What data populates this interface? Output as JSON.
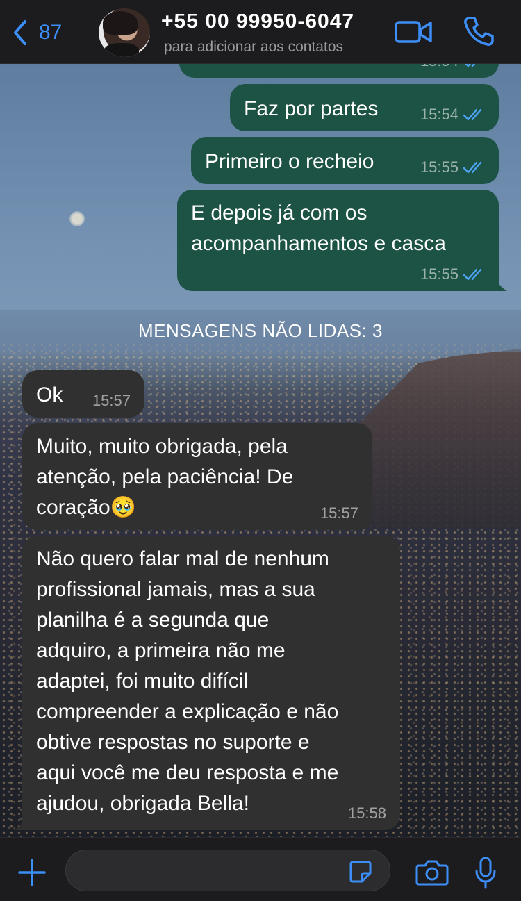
{
  "header": {
    "back_count": "87",
    "contact_name": "+55 00 99950-6047",
    "contact_subtitle": "para adicionar aos contatos",
    "accent_color": "#3d8ef7",
    "icons": [
      "chevron-left-icon",
      "video-camera-icon",
      "phone-icon"
    ]
  },
  "messages_read": [
    {
      "text": "Faz por partes",
      "time": "15:54",
      "direction": "outgoing",
      "status": "read"
    },
    {
      "text": "Primeiro o recheio",
      "time": "15:55",
      "direction": "outgoing",
      "status": "read"
    },
    {
      "text": "E depois já com os\nacompanhamentos e casca",
      "time": "15:55",
      "direction": "outgoing",
      "status": "read"
    }
  ],
  "partial_top_message_time": "15:54",
  "unread_banner": "MENSAGENS NÃO LIDAS: 3",
  "messages_unread": [
    {
      "text": "Ok",
      "time": "15:57",
      "direction": "incoming"
    },
    {
      "text": "Muito, muito obrigada, pela\natenção, pela paciência! De\ncoração🥹",
      "time": "15:57",
      "direction": "incoming"
    },
    {
      "text": "Não quero falar mal de nenhum\nprofissional jamais, mas a sua\nplanilha é a segunda que\nadquiro, a primeira não me\nadaptei, foi muito difícil\ncompreender a explicação e não\nobtive respostas no suporte e\naqui você me deu resposta e me\najudou, obrigada Bella!",
      "time": "15:58",
      "direction": "incoming"
    }
  ],
  "composer": {
    "value": "",
    "icons": [
      "plus-icon",
      "sticker-icon",
      "camera-icon",
      "microphone-icon"
    ]
  },
  "colors": {
    "outgoing_bubble": "#1d5344",
    "incoming_bubble": "#303030",
    "read_ticks": "#4fa3f7"
  }
}
